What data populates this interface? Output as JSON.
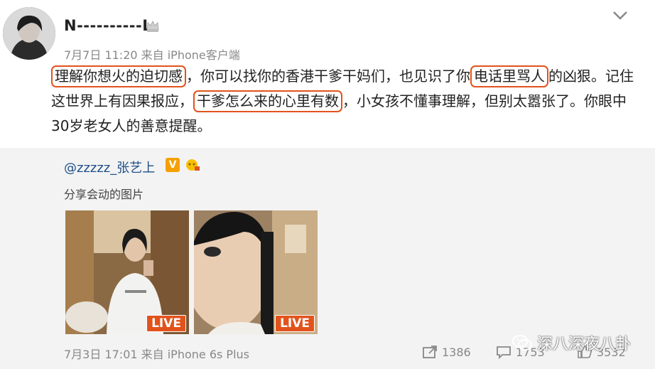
{
  "post": {
    "username": "N----------L",
    "meta": "7月7日 11:20 来自 iPhone客户端",
    "text_1": "理解你想火的迫切感",
    "text_2": "，你可以找你的香港干爹干妈们，也见识了你",
    "text_3": "电话里骂人",
    "text_4": "的凶狠。记住这世界上有因果报应，",
    "text_5": "干爹怎么来的心里有数",
    "text_6": "，小女孩不懂事理解，但别太嚣张了。你眼中30岁老女人的善意提醒。"
  },
  "repost": {
    "username": "@zzzzz_张艺上",
    "verified_mark": "V",
    "text": "分享会动的图片",
    "images": [
      {
        "badge": "LIVE"
      },
      {
        "badge": "LIVE"
      }
    ],
    "time": "7月3日 17:01 来自 iPhone 6s Plus",
    "reposts": "1386",
    "comments": "1753",
    "likes": "3532"
  },
  "watermark": {
    "text": "深八深夜八卦"
  },
  "colors": {
    "highlight": "#e2531c",
    "link": "#1f4f87",
    "badge_orange": "#f6a000"
  }
}
